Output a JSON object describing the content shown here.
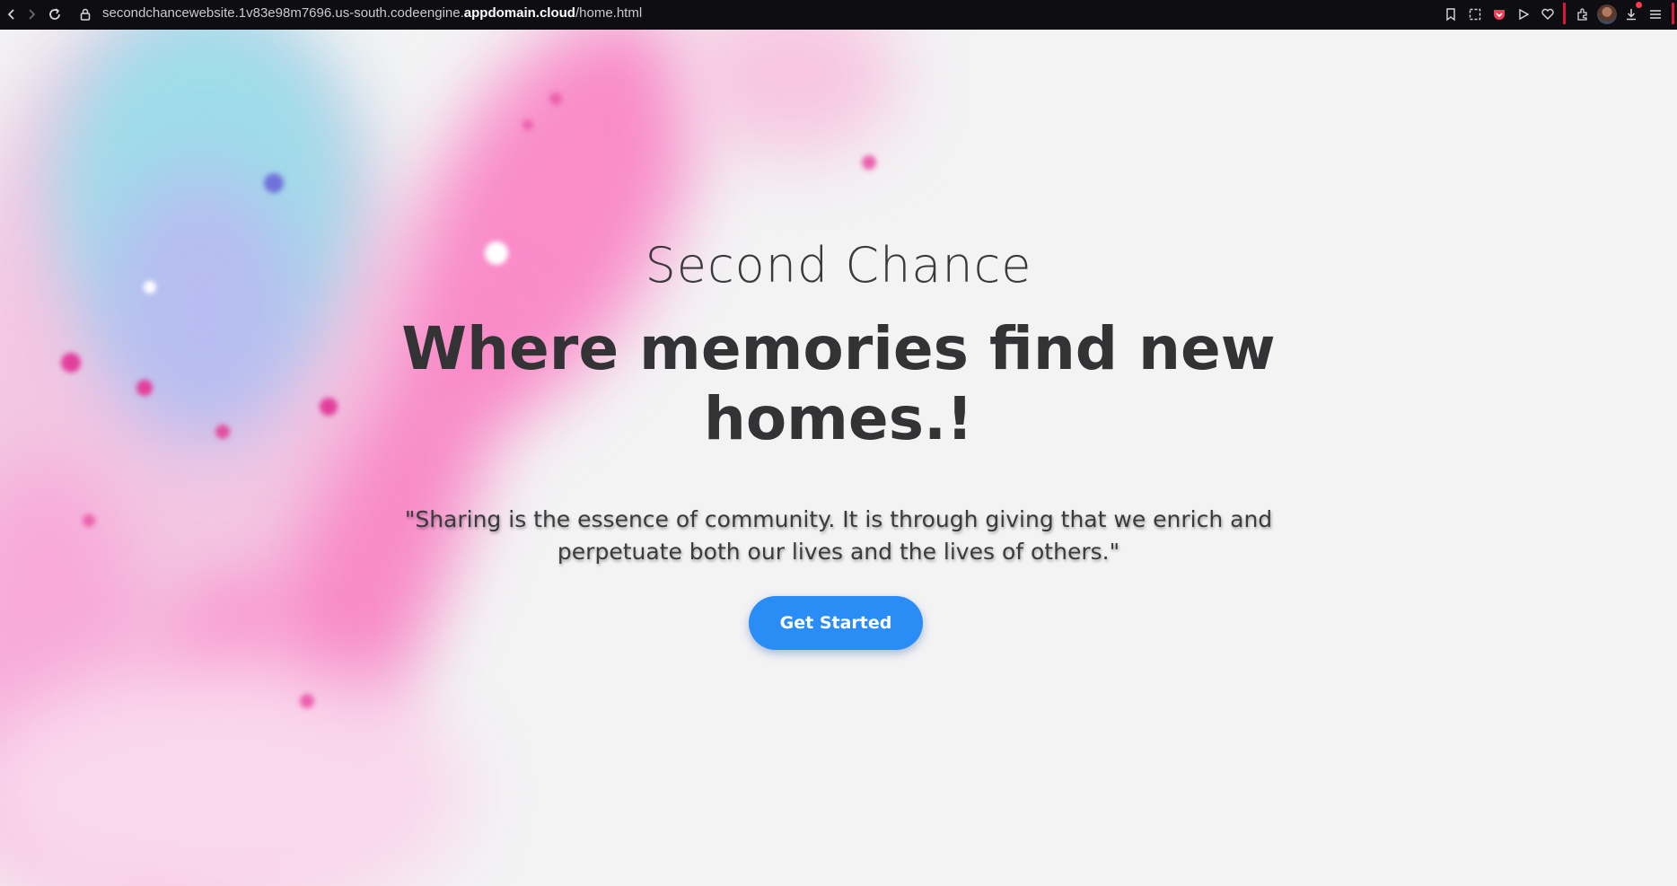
{
  "browser": {
    "url_prefix": "secondchancewebsite.1v83e98m7696.us-south.codeengine.",
    "url_domain": "appdomain.cloud",
    "url_path": "/home.html"
  },
  "hero": {
    "brand": "Second Chance",
    "headline": "Where memories find new homes.!",
    "quote": "\"Sharing is the essence of community. It is through giving that we enrich and perpetuate both our lives and the lives of others.\"",
    "cta_label": "Get Started"
  },
  "colors": {
    "accent": "#2a8df5",
    "text": "#333336",
    "topbar": "#0d0d12",
    "pink": "#ff4fb4",
    "cyan": "#8fd9e8"
  }
}
